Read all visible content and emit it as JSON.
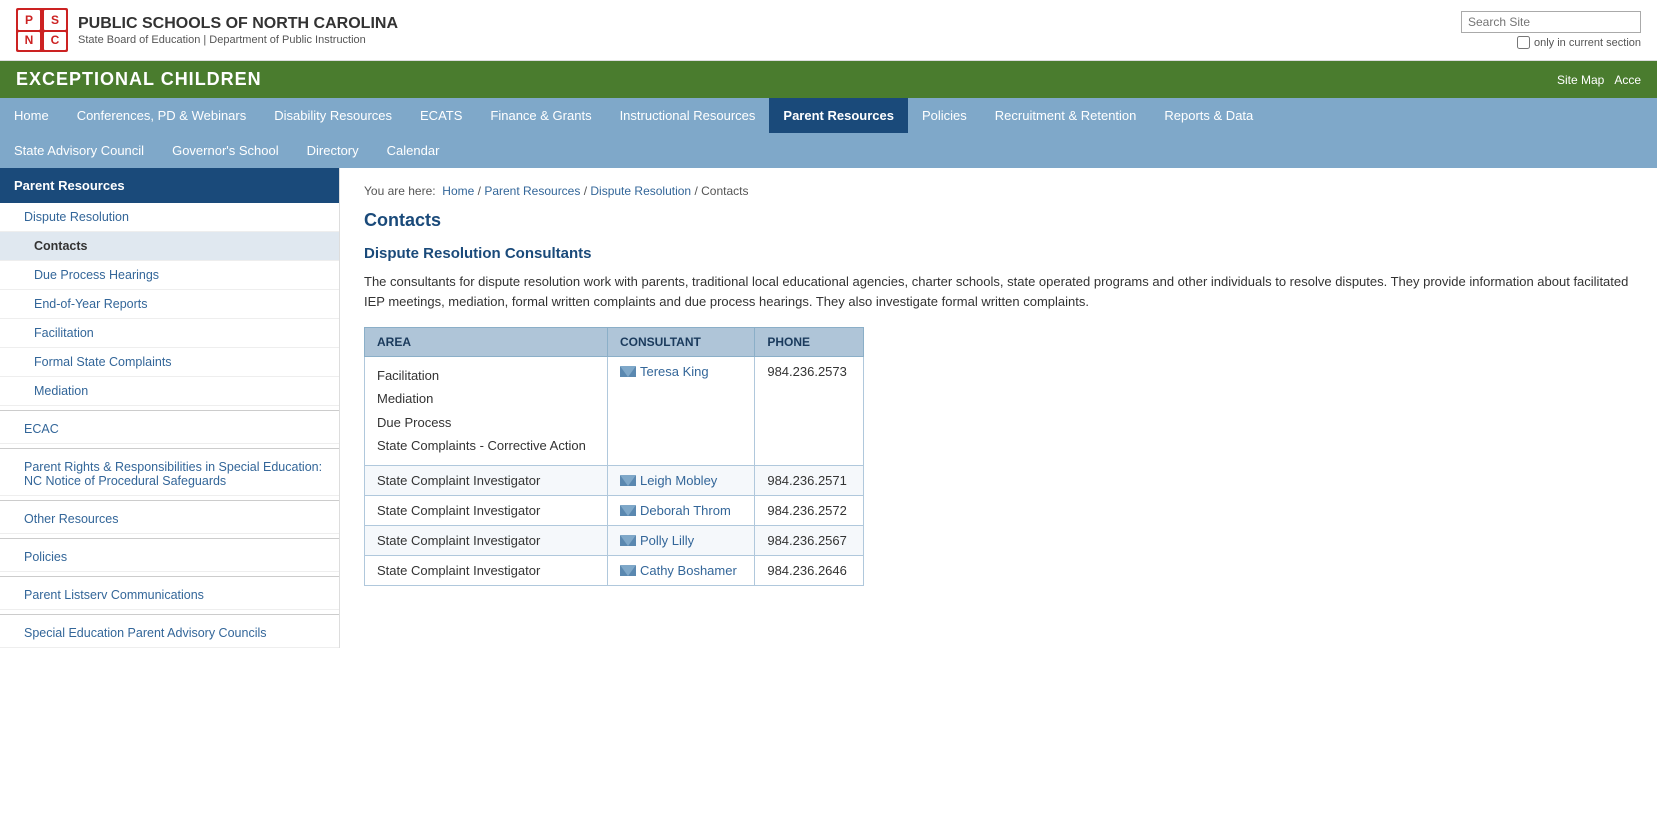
{
  "header": {
    "org_line1": "PUBLIC SCHOOLS OF NORTH CAROLINA",
    "org_line2": "State Board of Education | Department of Public Instruction",
    "search_placeholder": "Search Site",
    "search_checkbox_label": "only in current section"
  },
  "banner": {
    "title": "EXCEPTIONAL CHILDREN",
    "links": [
      "Site Map",
      "Acce"
    ]
  },
  "nav": {
    "row1": [
      {
        "label": "Home",
        "active": false
      },
      {
        "label": "Conferences, PD & Webinars",
        "active": false
      },
      {
        "label": "Disability Resources",
        "active": false
      },
      {
        "label": "ECATS",
        "active": false
      },
      {
        "label": "Finance & Grants",
        "active": false
      },
      {
        "label": "Instructional Resources",
        "active": false
      },
      {
        "label": "Parent Resources",
        "active": true
      },
      {
        "label": "Policies",
        "active": false
      },
      {
        "label": "Recruitment & Retention",
        "active": false
      },
      {
        "label": "Reports & Data",
        "active": false
      }
    ],
    "row2": [
      {
        "label": "State Advisory Council",
        "active": false
      },
      {
        "label": "Governor's School",
        "active": false
      },
      {
        "label": "Directory",
        "active": false
      },
      {
        "label": "Calendar",
        "active": false
      }
    ]
  },
  "sidebar": {
    "header": "Parent Resources",
    "items": [
      {
        "label": "Dispute Resolution",
        "indent": 1,
        "active": false
      },
      {
        "label": "Contacts",
        "indent": 2,
        "active": true
      },
      {
        "label": "Due Process Hearings",
        "indent": 2,
        "active": false
      },
      {
        "label": "End-of-Year Reports",
        "indent": 2,
        "active": false
      },
      {
        "label": "Facilitation",
        "indent": 2,
        "active": false
      },
      {
        "label": "Formal State Complaints",
        "indent": 2,
        "active": false
      },
      {
        "label": "Mediation",
        "indent": 2,
        "active": false
      },
      {
        "label": "ECAC",
        "indent": 1,
        "active": false
      },
      {
        "label": "Parent Rights & Responsibilities in Special Education: NC Notice of Procedural Safeguards",
        "indent": 1,
        "active": false
      },
      {
        "label": "Other Resources",
        "indent": 1,
        "active": false
      },
      {
        "label": "Policies",
        "indent": 1,
        "active": false
      },
      {
        "label": "Parent Listserv Communications",
        "indent": 1,
        "active": false
      },
      {
        "label": "Special Education Parent Advisory Councils",
        "indent": 1,
        "active": false
      }
    ]
  },
  "breadcrumb": {
    "items": [
      "Home",
      "Parent Resources",
      "Dispute Resolution",
      "Contacts"
    ],
    "separator": " / "
  },
  "page": {
    "title": "Contacts",
    "section_title": "Dispute Resolution Consultants",
    "intro": "The consultants for dispute resolution work with parents, traditional local educational agencies, charter schools, state operated programs and other individuals to resolve disputes.  They provide information about facilitated IEP meetings, mediation, formal written complaints and due process hearings.  They also investigate formal written complaints."
  },
  "table": {
    "headers": [
      "AREA",
      "CONSULTANT",
      "PHONE"
    ],
    "rows": [
      {
        "area": "Facilitation\nMediation\nDue Process\nState Complaints - Corrective Action",
        "consultant": "Teresa King",
        "phone": "984.236.2573"
      },
      {
        "area": "State Complaint Investigator",
        "consultant": "Leigh Mobley",
        "phone": "984.236.2571"
      },
      {
        "area": "State Complaint Investigator",
        "consultant": "Deborah Throm",
        "phone": "984.236.2572"
      },
      {
        "area": "State Complaint Investigator",
        "consultant": "Polly Lilly",
        "phone": "984.236.2567"
      },
      {
        "area": "State Complaint Investigator",
        "consultant": "Cathy Boshamer",
        "phone": "984.236.2646"
      }
    ]
  }
}
